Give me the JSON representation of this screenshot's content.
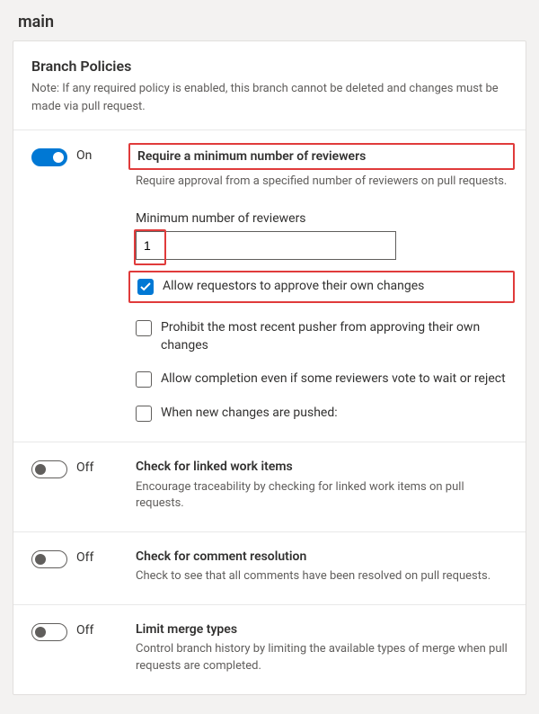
{
  "page": {
    "title": "main"
  },
  "section": {
    "title": "Branch Policies",
    "note": "Note: If any required policy is enabled, this branch cannot be deleted and changes must be made via pull request."
  },
  "toggle_labels": {
    "on": "On",
    "off": "Off"
  },
  "policies": {
    "min_reviewers": {
      "title": "Require a minimum number of reviewers",
      "desc": "Require approval from a specified number of reviewers on pull requests.",
      "field_label": "Minimum number of reviewers",
      "value": "1",
      "checkboxes": {
        "allow_self": "Allow requestors to approve their own changes",
        "prohibit_pusher": "Prohibit the most recent pusher from approving their own changes",
        "allow_completion": "Allow completion even if some reviewers vote to wait or reject",
        "new_changes": "When new changes are pushed:"
      }
    },
    "linked_work_items": {
      "title": "Check for linked work items",
      "desc": "Encourage traceability by checking for linked work items on pull requests."
    },
    "comment_resolution": {
      "title": "Check for comment resolution",
      "desc": "Check to see that all comments have been resolved on pull requests."
    },
    "limit_merge": {
      "title": "Limit merge types",
      "desc": "Control branch history by limiting the available types of merge when pull requests are completed."
    }
  }
}
